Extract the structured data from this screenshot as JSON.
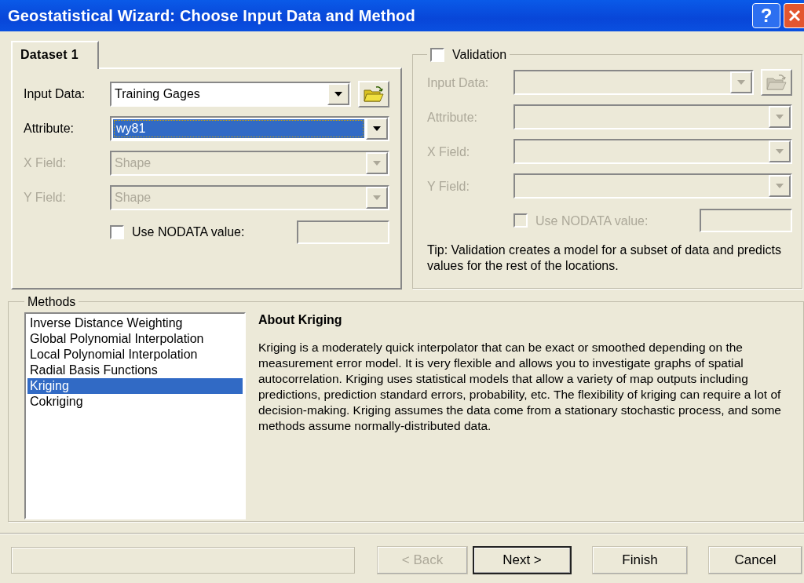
{
  "window": {
    "title": "Geostatistical Wizard: Choose Input Data and Method",
    "controls": [
      {
        "kind": "help",
        "label": "?"
      },
      {
        "kind": "close"
      }
    ]
  },
  "dataset": {
    "tab": {
      "label": "Dataset 1",
      "selected": true
    },
    "fields": [
      {
        "label": "Input Data:",
        "value": "Training Gages",
        "disabled": false,
        "highlighted": false,
        "browse": true
      },
      {
        "label": "Attribute:",
        "value": "wy81",
        "disabled": false,
        "highlighted": true,
        "browse": false
      },
      {
        "label": "X Field:",
        "value": "Shape",
        "disabled": true,
        "highlighted": false,
        "browse": false
      },
      {
        "label": "Y Field:",
        "value": "Shape",
        "disabled": true,
        "highlighted": false,
        "browse": false
      }
    ],
    "nodata": {
      "label": "Use NODATA value:",
      "checked": false,
      "disabled": false
    }
  },
  "validation": {
    "label": "Validation",
    "checked": false,
    "fields": [
      {
        "label": "Input Data:",
        "disabled": true,
        "browse": true
      },
      {
        "label": "Attribute:",
        "disabled": true,
        "browse": false
      },
      {
        "label": "X Field:",
        "disabled": true,
        "browse": false
      },
      {
        "label": "Y Field:",
        "disabled": true,
        "browse": false
      }
    ],
    "nodata": {
      "label": "Use NODATA value:",
      "checked": false,
      "disabled": true
    },
    "tip": "Tip:  Validation creates a model for a subset of data and predicts values for the rest of the locations."
  },
  "methods": {
    "label": "Methods",
    "items": [
      {
        "label": "Inverse Distance Weighting",
        "selected": false
      },
      {
        "label": "Global Polynomial Interpolation",
        "selected": false
      },
      {
        "label": "Local Polynomial Interpolation",
        "selected": false
      },
      {
        "label": "Radial Basis Functions",
        "selected": false
      },
      {
        "label": "Kriging",
        "selected": true
      },
      {
        "label": "Cokriging",
        "selected": false
      }
    ],
    "about": {
      "title": "About Kriging",
      "text": "Kriging is a moderately quick interpolator that can be exact or smoothed depending on the measurement error model. It is very flexible and allows you to investigate graphs of spatial autocorrelation. Kriging uses statistical models that allow a variety of map outputs including predictions, prediction standard errors, probability, etc. The flexibility of kriging can require a lot of decision-making. Kriging assumes the data come from a stationary stochastic process, and some methods assume normally-distributed data."
    }
  },
  "buttons": [
    {
      "label": "< Back",
      "disabled": true,
      "default": false
    },
    {
      "label": "Next >",
      "disabled": false,
      "default": true
    },
    {
      "label": "Finish",
      "disabled": false,
      "default": false
    },
    {
      "label": "Cancel",
      "disabled": false,
      "default": false
    }
  ]
}
